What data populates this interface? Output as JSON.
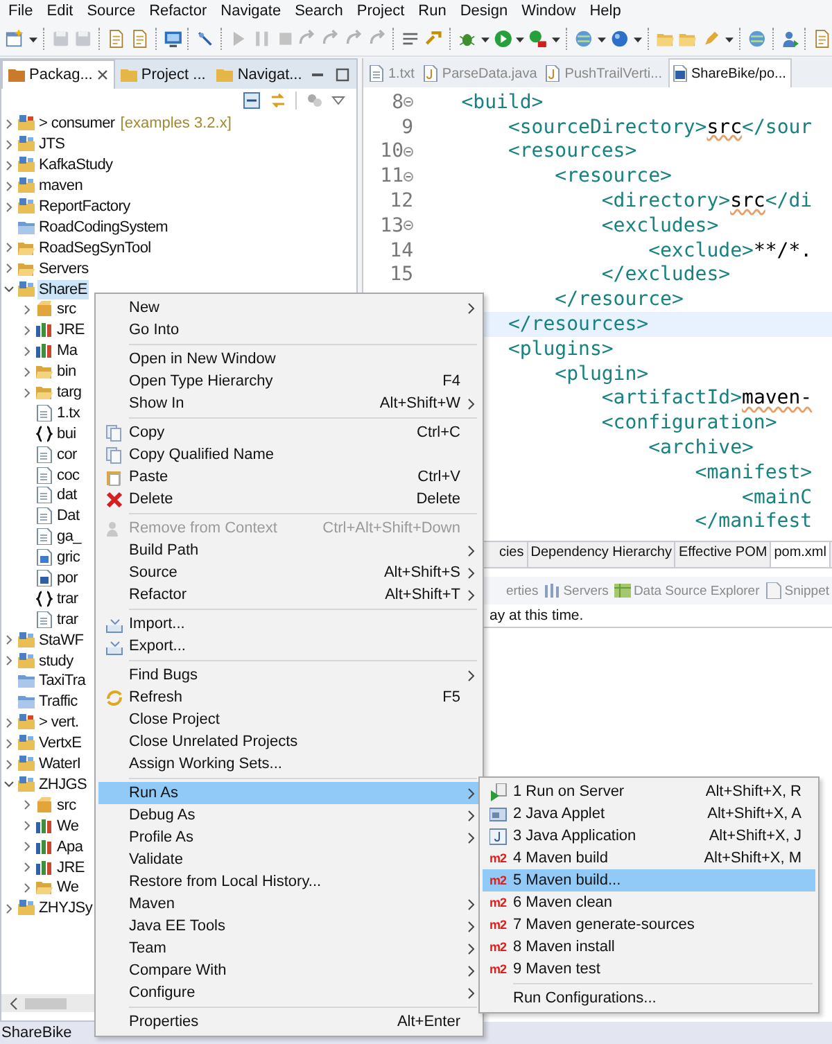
{
  "menubar": [
    "File",
    "Edit",
    "Source",
    "Refactor",
    "Navigate",
    "Search",
    "Project",
    "Run",
    "Design",
    "Window",
    "Help"
  ],
  "left_panel": {
    "tabs": [
      {
        "label": "Packag...",
        "selected": true
      },
      {
        "label": "Project ...",
        "selected": false
      },
      {
        "label": "Navigat...",
        "selected": false
      }
    ]
  },
  "tree": [
    {
      "label": "> consumer",
      "decoration": "[examples 3.2.x]",
      "kind": "maven-project",
      "expanded": false,
      "selected": false
    },
    {
      "label": "JTS",
      "kind": "project",
      "expanded": false,
      "selected": false
    },
    {
      "label": "KafkaStudy",
      "kind": "project",
      "expanded": false,
      "selected": false
    },
    {
      "label": "maven",
      "kind": "project",
      "expanded": false,
      "selected": false
    },
    {
      "label": "ReportFactory",
      "kind": "project",
      "expanded": false,
      "selected": false
    },
    {
      "label": "RoadCodingSystem",
      "kind": "closed-project",
      "selected": false
    },
    {
      "label": "RoadSegSynTool",
      "kind": "open-folder",
      "expanded": false,
      "selected": false
    },
    {
      "label": "Servers",
      "kind": "open-folder",
      "expanded": false,
      "selected": false
    },
    {
      "label": "ShareE",
      "kind": "project",
      "expanded": true,
      "selected": true,
      "children": [
        {
          "label": "src",
          "kind": "package",
          "expanded": false,
          "selected": false
        },
        {
          "label": "JRE",
          "kind": "library",
          "expanded": false,
          "selected": false
        },
        {
          "label": "Ma",
          "kind": "library",
          "expanded": false,
          "selected": false
        },
        {
          "label": "bin",
          "kind": "open-folder",
          "expanded": false,
          "selected": false
        },
        {
          "label": "targ",
          "kind": "open-folder",
          "expanded": false,
          "selected": false
        },
        {
          "label": "1.tx",
          "kind": "file",
          "selected": false
        },
        {
          "label": "bui",
          "kind": "json",
          "selected": false
        },
        {
          "label": "cor",
          "kind": "file",
          "selected": false
        },
        {
          "label": "coc",
          "kind": "file",
          "selected": false
        },
        {
          "label": "dat",
          "kind": "file",
          "selected": false
        },
        {
          "label": "Dat",
          "kind": "file",
          "selected": false
        },
        {
          "label": "ga_",
          "kind": "file",
          "selected": false
        },
        {
          "label": "gric",
          "kind": "image-file",
          "selected": false
        },
        {
          "label": "por",
          "kind": "maven-file",
          "selected": false
        },
        {
          "label": "trar",
          "kind": "json",
          "selected": false
        },
        {
          "label": "trar",
          "kind": "file",
          "selected": false
        }
      ]
    },
    {
      "label": "StaWF",
      "kind": "project",
      "expanded": false,
      "selected": false
    },
    {
      "label": "study",
      "kind": "project",
      "expanded": false,
      "selected": false
    },
    {
      "label": "TaxiTra",
      "kind": "closed-project",
      "selected": false
    },
    {
      "label": "Traffic",
      "kind": "closed-project",
      "selected": false
    },
    {
      "label": "> vert.",
      "kind": "maven-project",
      "expanded": false,
      "selected": false
    },
    {
      "label": "VertxE",
      "kind": "project",
      "expanded": false,
      "selected": false
    },
    {
      "label": "WaterI",
      "kind": "project",
      "expanded": false,
      "selected": false
    },
    {
      "label": "ZHJGS",
      "kind": "project",
      "expanded": true,
      "selected": false,
      "children": [
        {
          "label": "src",
          "kind": "package",
          "expanded": false,
          "selected": false
        },
        {
          "label": "We",
          "kind": "library",
          "expanded": false,
          "selected": false
        },
        {
          "label": "Apa",
          "kind": "library",
          "expanded": false,
          "selected": false
        },
        {
          "label": "JRE",
          "kind": "library",
          "expanded": false,
          "selected": false
        },
        {
          "label": "We",
          "kind": "open-folder",
          "expanded": false,
          "selected": false
        }
      ]
    },
    {
      "label": "ZHYJSy",
      "kind": "project",
      "expanded": false,
      "selected": false
    }
  ],
  "editor": {
    "tabs": [
      {
        "label": "1.txt",
        "kind": "text",
        "selected": false
      },
      {
        "label": "ParseData.java",
        "kind": "java",
        "selected": false
      },
      {
        "label": "PushTrailVerti...",
        "kind": "java",
        "selected": false
      },
      {
        "label": "ShareBike/po...",
        "kind": "maven",
        "selected": true
      }
    ],
    "lines": [
      {
        "number": "8",
        "foldable": true,
        "current": false,
        "tokens": [
          {
            "kind": "tag",
            "text": "    <build>"
          }
        ]
      },
      {
        "number": "9",
        "foldable": false,
        "current": false,
        "tokens": [
          {
            "kind": "tag",
            "text": "        <sourceDirectory>"
          },
          {
            "kind": "text-error",
            "text": "src"
          },
          {
            "kind": "tag",
            "text": "</sour"
          }
        ]
      },
      {
        "number": "10",
        "foldable": true,
        "current": false,
        "tokens": [
          {
            "kind": "tag",
            "text": "        <resources>"
          }
        ]
      },
      {
        "number": "11",
        "foldable": true,
        "current": false,
        "tokens": [
          {
            "kind": "tag",
            "text": "            <resource>"
          }
        ]
      },
      {
        "number": "12",
        "foldable": false,
        "current": false,
        "tokens": [
          {
            "kind": "tag",
            "text": "                <directory>"
          },
          {
            "kind": "text-error",
            "text": "src"
          },
          {
            "kind": "tag",
            "text": "</di"
          }
        ]
      },
      {
        "number": "13",
        "foldable": true,
        "current": false,
        "tokens": [
          {
            "kind": "tag",
            "text": "                <excludes>"
          }
        ]
      },
      {
        "number": "14",
        "foldable": false,
        "current": false,
        "tokens": [
          {
            "kind": "tag",
            "text": "                    <exclude>"
          },
          {
            "kind": "text",
            "text": "**/*."
          }
        ]
      },
      {
        "number": "15",
        "foldable": false,
        "current": false,
        "tokens": [
          {
            "kind": "tag",
            "text": "                </excludes>"
          }
        ]
      },
      {
        "foldable": false,
        "current": false,
        "tokens": [
          {
            "kind": "tag",
            "text": "            </resource>"
          }
        ]
      },
      {
        "foldable": false,
        "current": true,
        "tokens": [
          {
            "kind": "tag",
            "text": "        </resources>"
          }
        ]
      },
      {
        "foldable": false,
        "current": false,
        "tokens": [
          {
            "kind": "tag",
            "text": "        <plugins>"
          }
        ]
      },
      {
        "foldable": false,
        "current": false,
        "tokens": [
          {
            "kind": "tag",
            "text": "            <plugin>"
          }
        ]
      },
      {
        "foldable": false,
        "current": false,
        "tokens": [
          {
            "kind": "tag",
            "text": "                <artifactId>"
          },
          {
            "kind": "text-error",
            "text": "maven-"
          }
        ]
      },
      {
        "foldable": false,
        "current": false,
        "tokens": [
          {
            "kind": "tag",
            "text": "                <configuration>"
          }
        ]
      },
      {
        "foldable": false,
        "current": false,
        "tokens": [
          {
            "kind": "tag",
            "text": "                    <archive>"
          }
        ]
      },
      {
        "foldable": false,
        "current": false,
        "tokens": [
          {
            "kind": "tag",
            "text": "                        <manifest>"
          }
        ]
      },
      {
        "foldable": false,
        "current": false,
        "tokens": [
          {
            "kind": "tag",
            "text": "                            <mainC"
          }
        ]
      },
      {
        "foldable": false,
        "current": false,
        "tokens": [
          {
            "kind": "tag",
            "text": "                        </manifest"
          }
        ]
      }
    ]
  },
  "bottom_pane": {
    "tabs": [
      {
        "label": "cies",
        "selected": false
      },
      {
        "label": "Dependency Hierarchy",
        "selected": false
      },
      {
        "label": "Effective POM",
        "selected": false
      },
      {
        "label": "pom.xml",
        "selected": true
      }
    ],
    "views": [
      {
        "label": "erties"
      },
      {
        "label": "Servers",
        "kind": "servers"
      },
      {
        "label": "Data Source Explorer",
        "kind": "database"
      },
      {
        "label": "Snippet",
        "kind": "snippets"
      }
    ],
    "message": "ay at this time."
  },
  "context_menu": {
    "groups": [
      [
        {
          "label": "New",
          "submenu": true,
          "disabled": false,
          "selected": false
        },
        {
          "label": "Go Into",
          "submenu": false,
          "disabled": false,
          "selected": false
        }
      ],
      [
        {
          "label": "Open in New Window",
          "submenu": false,
          "disabled": false,
          "selected": false
        },
        {
          "label": "Open Type Hierarchy",
          "shortcut": "F4",
          "submenu": false,
          "disabled": false,
          "selected": false
        },
        {
          "label": "Show In",
          "shortcut": "Alt+Shift+W",
          "submenu": true,
          "disabled": false,
          "selected": false
        }
      ],
      [
        {
          "label": "Copy",
          "shortcut": "Ctrl+C",
          "kind": "copy",
          "submenu": false,
          "disabled": false,
          "selected": false
        },
        {
          "label": "Copy Qualified Name",
          "kind": "copy",
          "submenu": false,
          "disabled": false,
          "selected": false
        },
        {
          "label": "Paste",
          "shortcut": "Ctrl+V",
          "kind": "paste",
          "submenu": false,
          "disabled": false,
          "selected": false
        },
        {
          "label": "Delete",
          "shortcut": "Delete",
          "kind": "delete",
          "submenu": false,
          "disabled": false,
          "selected": false
        }
      ],
      [
        {
          "label": "Remove from Context",
          "shortcut": "Ctrl+Alt+Shift+Down",
          "kind": "context",
          "submenu": false,
          "disabled": true,
          "selected": false
        },
        {
          "label": "Build Path",
          "submenu": true,
          "disabled": false,
          "selected": false
        },
        {
          "label": "Source",
          "shortcut": "Alt+Shift+S",
          "submenu": true,
          "disabled": false,
          "selected": false
        },
        {
          "label": "Refactor",
          "shortcut": "Alt+Shift+T",
          "submenu": true,
          "disabled": false,
          "selected": false
        }
      ],
      [
        {
          "label": "Import...",
          "kind": "tray",
          "submenu": false,
          "disabled": false,
          "selected": false
        },
        {
          "label": "Export...",
          "kind": "tray",
          "submenu": false,
          "disabled": false,
          "selected": false
        }
      ],
      [
        {
          "label": "Find Bugs",
          "submenu": true,
          "disabled": false,
          "selected": false
        },
        {
          "label": "Refresh",
          "shortcut": "F5",
          "kind": "refresh",
          "submenu": false,
          "disabled": false,
          "selected": false
        },
        {
          "label": "Close Project",
          "submenu": false,
          "disabled": false,
          "selected": false
        },
        {
          "label": "Close Unrelated Projects",
          "submenu": false,
          "disabled": false,
          "selected": false
        },
        {
          "label": "Assign Working Sets...",
          "submenu": false,
          "disabled": false,
          "selected": false
        }
      ],
      [
        {
          "label": "Run As",
          "submenu": true,
          "disabled": false,
          "selected": true
        },
        {
          "label": "Debug As",
          "submenu": true,
          "disabled": false,
          "selected": false
        },
        {
          "label": "Profile As",
          "submenu": true,
          "disabled": false,
          "selected": false
        },
        {
          "label": "Validate",
          "submenu": false,
          "disabled": false,
          "selected": false
        },
        {
          "label": "Restore from Local History...",
          "submenu": false,
          "disabled": false,
          "selected": false
        },
        {
          "label": "Maven",
          "submenu": true,
          "disabled": false,
          "selected": false
        },
        {
          "label": "Java EE Tools",
          "submenu": true,
          "disabled": false,
          "selected": false
        },
        {
          "label": "Team",
          "submenu": true,
          "disabled": false,
          "selected": false
        },
        {
          "label": "Compare With",
          "submenu": true,
          "disabled": false,
          "selected": false
        },
        {
          "label": "Configure",
          "submenu": true,
          "disabled": false,
          "selected": false
        }
      ],
      [
        {
          "label": "Properties",
          "shortcut": "Alt+Enter",
          "submenu": false,
          "disabled": false,
          "selected": false
        }
      ]
    ]
  },
  "submenu": {
    "groups": [
      [
        {
          "label": "1 Run on Server",
          "shortcut": "Alt+Shift+X, R",
          "kind": "server",
          "selected": false
        },
        {
          "label": "2 Java Applet",
          "shortcut": "Alt+Shift+X, A",
          "kind": "applet",
          "selected": false
        },
        {
          "label": "3 Java Application",
          "shortcut": "Alt+Shift+X, J",
          "kind": "java-app",
          "selected": false
        },
        {
          "label": "4 Maven build",
          "shortcut": "Alt+Shift+X, M",
          "kind": "m2",
          "icon_text": "m2",
          "selected": false
        },
        {
          "label": "5 Maven build...",
          "kind": "m2",
          "icon_text": "m2",
          "selected": true
        },
        {
          "label": "6 Maven clean",
          "kind": "m2",
          "icon_text": "m2",
          "selected": false
        },
        {
          "label": "7 Maven generate-sources",
          "kind": "m2",
          "icon_text": "m2",
          "selected": false
        },
        {
          "label": "8 Maven install",
          "kind": "m2",
          "icon_text": "m2",
          "selected": false
        },
        {
          "label": "9 Maven test",
          "kind": "m2",
          "icon_text": "m2",
          "selected": false
        }
      ],
      [
        {
          "label": "Run Configurations...",
          "selected": false
        }
      ]
    ]
  },
  "status_bar": {
    "text": "ShareBike"
  }
}
